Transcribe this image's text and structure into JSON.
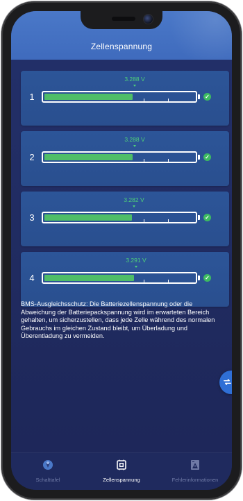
{
  "header": {
    "title": "Zellenspannung"
  },
  "cells": [
    {
      "index": "1",
      "voltage": "3.288 V",
      "level": 0.59
    },
    {
      "index": "2",
      "voltage": "3.288 V",
      "level": 0.59
    },
    {
      "index": "3",
      "voltage": "3.282 V",
      "level": 0.585
    },
    {
      "index": "4",
      "voltage": "3.291 V",
      "level": 0.595
    }
  ],
  "info": {
    "text": "BMS-Ausgleichsschutz: Die Batteriezellenspannung oder die Abweichung der Batteriepackspannung wird im erwarteten Bereich gehalten, um sicherzustellen, dass jede Zelle während des normalen Gebrauchs im gleichen Zustand bleibt, um Überladung und Überentladung zu vermeiden."
  },
  "fab": {
    "icon": "swap-arrows-icon"
  },
  "tabs": [
    {
      "label": "Schalttafel",
      "icon": "dashboard-icon",
      "active": false
    },
    {
      "label": "Zellenspannung",
      "icon": "cell-chip-icon",
      "active": true
    },
    {
      "label": "Fehlerinformationen",
      "icon": "warning-doc-icon",
      "active": false
    }
  ],
  "colors": {
    "header": "#4a78c8",
    "background": "#202b60",
    "card": "#2c5598",
    "voltage": "#4fd07a",
    "fill": "#4fbe68",
    "check": "#3dbb61",
    "fab": "#2f6fd6"
  }
}
